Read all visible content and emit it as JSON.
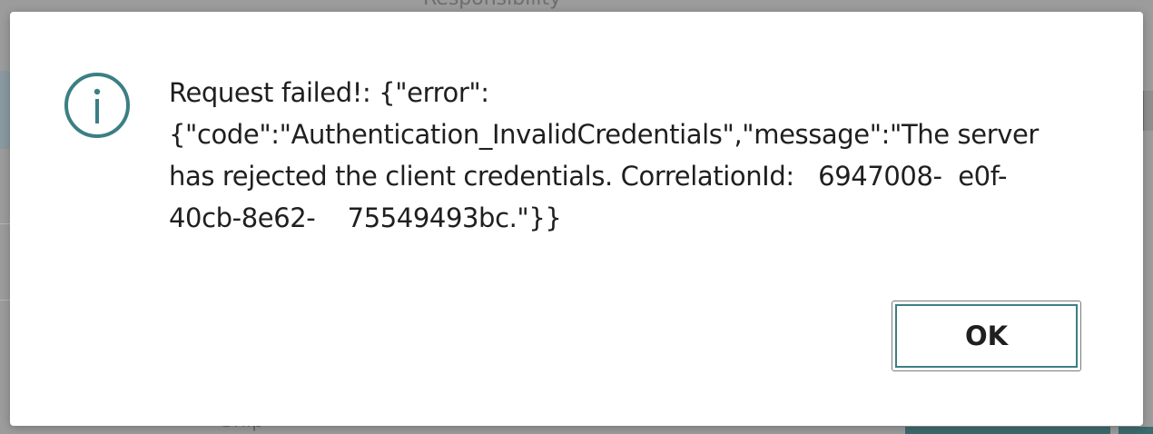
{
  "background": {
    "top_label": "Responsibility",
    "bottom_label": "Ship"
  },
  "dialog": {
    "icon": "info-icon",
    "accent_color": "#3b7f84",
    "message": "Request failed!: {\"error\":\n{\"code\":\"Authentication_InvalidCredentials\",\"message\":\"The server\nhas rejected the client credentials. CorrelationId:   6947008-  e0f-\n40cb-8e62-    75549493bc.\"}}",
    "ok_label": "OK"
  }
}
